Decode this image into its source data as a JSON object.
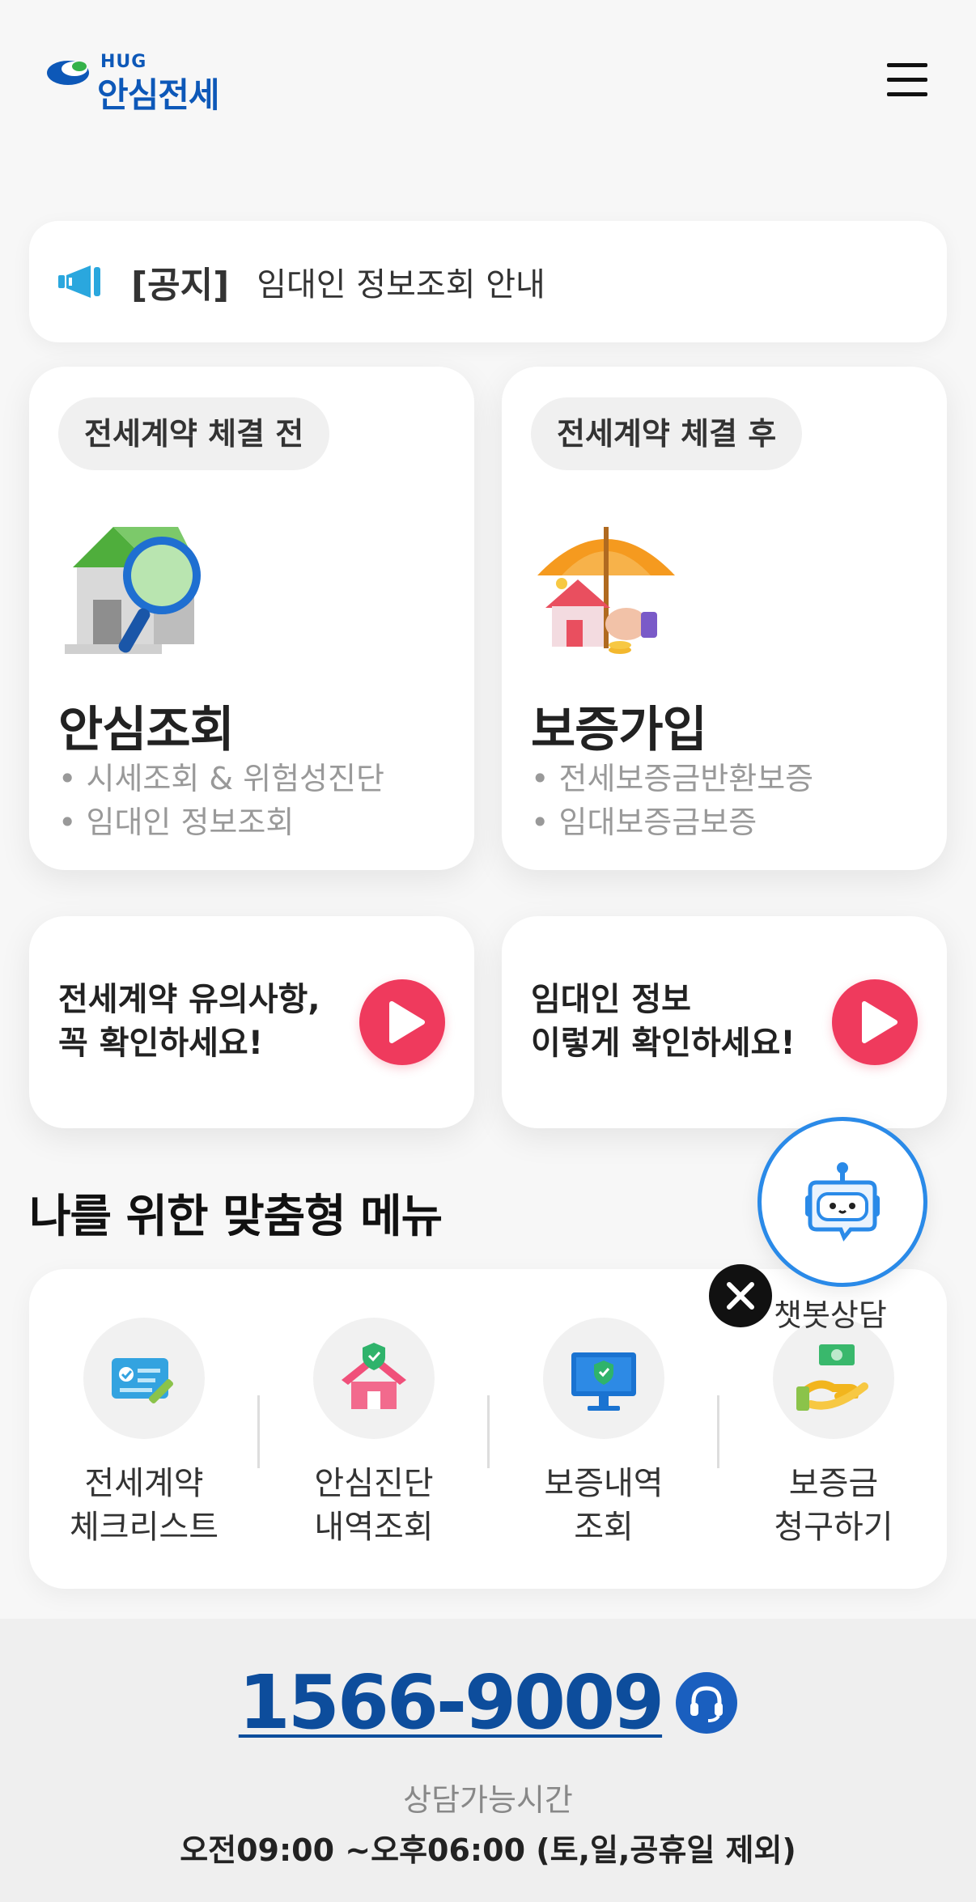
{
  "header": {
    "logo_small": "HUG",
    "logo_main": "안심전세",
    "menu_icon": "hamburger-menu-icon"
  },
  "notice": {
    "icon": "megaphone-icon",
    "tag": "[공지]",
    "text": "임대인 정보조회 안내"
  },
  "cards": [
    {
      "pill": "전세계약 체결 전",
      "illustration": "house-magnifier-illustration",
      "title": "안심조회",
      "items": [
        "• 시세조회 & 위험성진단",
        "• 임대인 정보조회"
      ]
    },
    {
      "pill": "전세계약 체결 후",
      "illustration": "house-umbrella-illustration",
      "title": "보증가입",
      "items": [
        "• 전세보증금반환보증",
        "• 임대보증금보증"
      ]
    }
  ],
  "videos": [
    {
      "line1": "전세계약 유의사항,",
      "line2": "꼭 확인하세요!",
      "icon": "play-icon"
    },
    {
      "line1": "임대인 정보",
      "line2": "이렇게 확인하세요!",
      "icon": "play-icon"
    }
  ],
  "section_title": "나를 위한 맞춤형 메뉴",
  "menu": [
    {
      "line1": "전세계약",
      "line2": "체크리스트",
      "icon": "checklist-card-icon"
    },
    {
      "line1": "안심진단",
      "line2": "내역조회",
      "icon": "house-shield-icon"
    },
    {
      "line1": "보증내역",
      "line2": "조회",
      "icon": "monitor-shield-icon"
    },
    {
      "line1": "보증금",
      "line2": "청구하기",
      "icon": "hand-money-icon"
    }
  ],
  "chatbot": {
    "label": "챗봇상담",
    "icon": "robot-icon",
    "close_icon": "close-icon"
  },
  "footer": {
    "phone": "1566-9009",
    "phone_icon": "headset-icon",
    "hours_label": "상담가능시간",
    "hours": "오전09:00 ~오후06:00 (토,일,공휴일 제외)"
  },
  "colors": {
    "brand_blue": "#0d58b8",
    "play_red": "#ef3a5d",
    "chatbot_border": "#2a8ae8",
    "phone_blue": "#0d4d9c"
  }
}
